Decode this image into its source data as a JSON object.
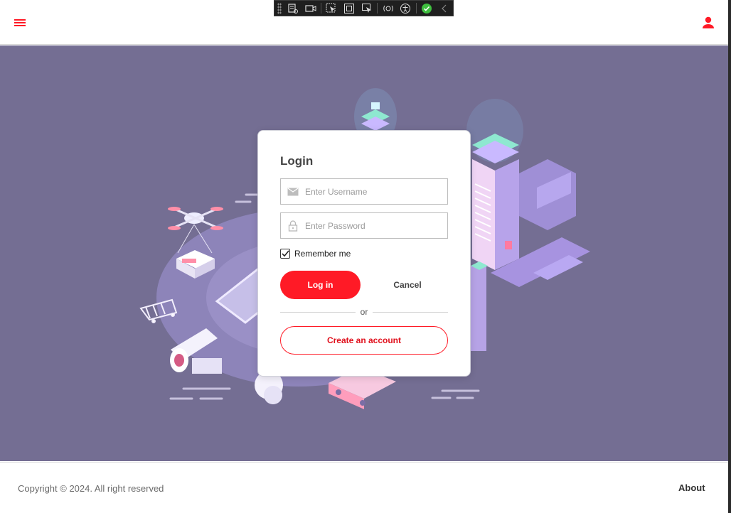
{
  "header": {
    "menu_icon": "hamburger-menu-icon",
    "user_icon": "user-account-icon",
    "accent_color": "#ff1a26"
  },
  "devtools": {
    "icons": [
      "live-visual-tree-icon",
      "video-record-icon",
      "select-element-icon",
      "display-layout-adorners-icon",
      "track-focus-icon",
      "hot-reload-icon",
      "accessibility-icon",
      "checkmark-status-icon",
      "collapse-chevron-icon"
    ]
  },
  "login": {
    "title": "Login",
    "username_placeholder": "Enter Username",
    "password_placeholder": "Enter Password",
    "remember_label": "Remember me",
    "remember_checked": true,
    "login_label": "Log in",
    "cancel_label": "Cancel",
    "or_label": "or",
    "create_label": "Create an account"
  },
  "footer": {
    "copyright": "Copyright © 2024. All right reserved",
    "about_label": "About"
  },
  "colors": {
    "background": "#746e93",
    "primary": "#ff1a26"
  }
}
